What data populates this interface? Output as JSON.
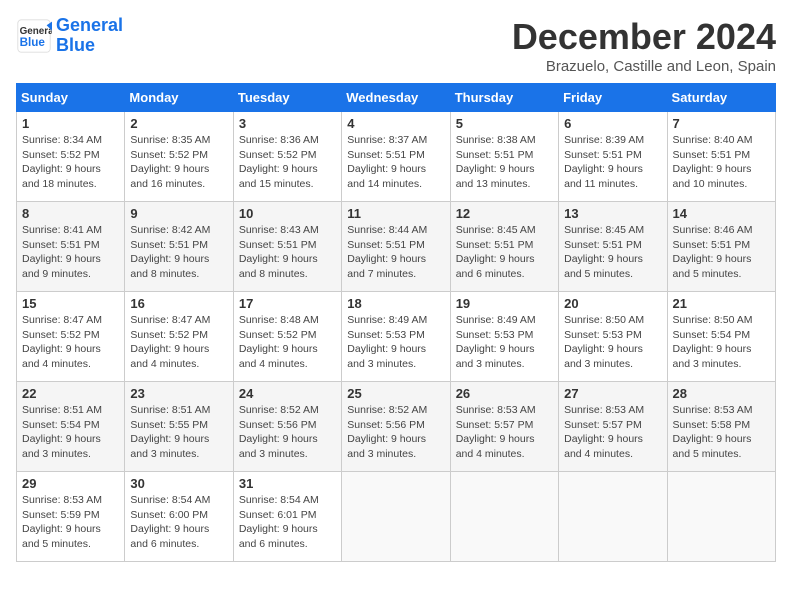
{
  "header": {
    "logo_line1": "General",
    "logo_line2": "Blue",
    "month": "December 2024",
    "location": "Brazuelo, Castille and Leon, Spain"
  },
  "days_of_week": [
    "Sunday",
    "Monday",
    "Tuesday",
    "Wednesday",
    "Thursday",
    "Friday",
    "Saturday"
  ],
  "weeks": [
    [
      {
        "day": "1",
        "sunrise": "8:34 AM",
        "sunset": "5:52 PM",
        "daylight": "9 hours and 18 minutes."
      },
      {
        "day": "2",
        "sunrise": "8:35 AM",
        "sunset": "5:52 PM",
        "daylight": "9 hours and 16 minutes."
      },
      {
        "day": "3",
        "sunrise": "8:36 AM",
        "sunset": "5:52 PM",
        "daylight": "9 hours and 15 minutes."
      },
      {
        "day": "4",
        "sunrise": "8:37 AM",
        "sunset": "5:51 PM",
        "daylight": "9 hours and 14 minutes."
      },
      {
        "day": "5",
        "sunrise": "8:38 AM",
        "sunset": "5:51 PM",
        "daylight": "9 hours and 13 minutes."
      },
      {
        "day": "6",
        "sunrise": "8:39 AM",
        "sunset": "5:51 PM",
        "daylight": "9 hours and 11 minutes."
      },
      {
        "day": "7",
        "sunrise": "8:40 AM",
        "sunset": "5:51 PM",
        "daylight": "9 hours and 10 minutes."
      }
    ],
    [
      {
        "day": "8",
        "sunrise": "8:41 AM",
        "sunset": "5:51 PM",
        "daylight": "9 hours and 9 minutes."
      },
      {
        "day": "9",
        "sunrise": "8:42 AM",
        "sunset": "5:51 PM",
        "daylight": "9 hours and 8 minutes."
      },
      {
        "day": "10",
        "sunrise": "8:43 AM",
        "sunset": "5:51 PM",
        "daylight": "9 hours and 8 minutes."
      },
      {
        "day": "11",
        "sunrise": "8:44 AM",
        "sunset": "5:51 PM",
        "daylight": "9 hours and 7 minutes."
      },
      {
        "day": "12",
        "sunrise": "8:45 AM",
        "sunset": "5:51 PM",
        "daylight": "9 hours and 6 minutes."
      },
      {
        "day": "13",
        "sunrise": "8:45 AM",
        "sunset": "5:51 PM",
        "daylight": "9 hours and 5 minutes."
      },
      {
        "day": "14",
        "sunrise": "8:46 AM",
        "sunset": "5:51 PM",
        "daylight": "9 hours and 5 minutes."
      }
    ],
    [
      {
        "day": "15",
        "sunrise": "8:47 AM",
        "sunset": "5:52 PM",
        "daylight": "9 hours and 4 minutes."
      },
      {
        "day": "16",
        "sunrise": "8:47 AM",
        "sunset": "5:52 PM",
        "daylight": "9 hours and 4 minutes."
      },
      {
        "day": "17",
        "sunrise": "8:48 AM",
        "sunset": "5:52 PM",
        "daylight": "9 hours and 4 minutes."
      },
      {
        "day": "18",
        "sunrise": "8:49 AM",
        "sunset": "5:53 PM",
        "daylight": "9 hours and 3 minutes."
      },
      {
        "day": "19",
        "sunrise": "8:49 AM",
        "sunset": "5:53 PM",
        "daylight": "9 hours and 3 minutes."
      },
      {
        "day": "20",
        "sunrise": "8:50 AM",
        "sunset": "5:53 PM",
        "daylight": "9 hours and 3 minutes."
      },
      {
        "day": "21",
        "sunrise": "8:50 AM",
        "sunset": "5:54 PM",
        "daylight": "9 hours and 3 minutes."
      }
    ],
    [
      {
        "day": "22",
        "sunrise": "8:51 AM",
        "sunset": "5:54 PM",
        "daylight": "9 hours and 3 minutes."
      },
      {
        "day": "23",
        "sunrise": "8:51 AM",
        "sunset": "5:55 PM",
        "daylight": "9 hours and 3 minutes."
      },
      {
        "day": "24",
        "sunrise": "8:52 AM",
        "sunset": "5:56 PM",
        "daylight": "9 hours and 3 minutes."
      },
      {
        "day": "25",
        "sunrise": "8:52 AM",
        "sunset": "5:56 PM",
        "daylight": "9 hours and 3 minutes."
      },
      {
        "day": "26",
        "sunrise": "8:53 AM",
        "sunset": "5:57 PM",
        "daylight": "9 hours and 4 minutes."
      },
      {
        "day": "27",
        "sunrise": "8:53 AM",
        "sunset": "5:57 PM",
        "daylight": "9 hours and 4 minutes."
      },
      {
        "day": "28",
        "sunrise": "8:53 AM",
        "sunset": "5:58 PM",
        "daylight": "9 hours and 5 minutes."
      }
    ],
    [
      {
        "day": "29",
        "sunrise": "8:53 AM",
        "sunset": "5:59 PM",
        "daylight": "9 hours and 5 minutes."
      },
      {
        "day": "30",
        "sunrise": "8:54 AM",
        "sunset": "6:00 PM",
        "daylight": "9 hours and 6 minutes."
      },
      {
        "day": "31",
        "sunrise": "8:54 AM",
        "sunset": "6:01 PM",
        "daylight": "9 hours and 6 minutes."
      },
      null,
      null,
      null,
      null
    ]
  ]
}
